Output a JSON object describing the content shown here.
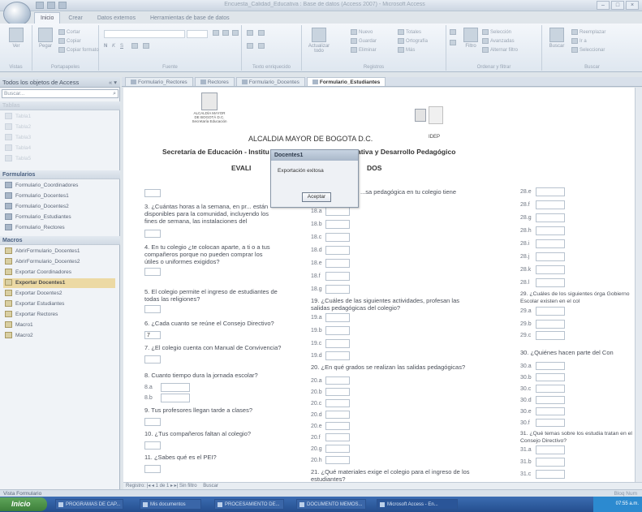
{
  "window": {
    "title": "Encuesta_Calidad_Educativa : Base de datos (Access 2007) - Microsoft Access"
  },
  "ribbon": {
    "tabs": [
      "Inicio",
      "Crear",
      "Datos externos",
      "Herramientas de base de datos"
    ],
    "groups": [
      "Vistas",
      "Portapapeles",
      "Fuente",
      "Texto enriquecido",
      "Registros",
      "Ordenar y filtrar",
      "Buscar"
    ],
    "buttons": {
      "ver": "Ver",
      "pegar": "Pegar",
      "cortar": "Cortar",
      "copiar": "Copiar",
      "copiar_formato": "Copiar formato",
      "actualizar": "Actualizar todo",
      "nuevo": "Nuevo",
      "guardar": "Guardar",
      "eliminar": "Eliminar",
      "totales": "Totales",
      "ortografia": "Ortografía",
      "mas": "Más",
      "filtro": "Filtro",
      "seleccion": "Selección",
      "avanzadas": "Avanzadas",
      "alternar_filtro": "Alternar filtro",
      "buscar": "Buscar",
      "reemplazar": "Reemplazar",
      "ir_a": "Ir a",
      "seleccionar": "Seleccionar"
    }
  },
  "nav": {
    "header": "Todos los objetos de Access",
    "search_placeholder": "Buscar...",
    "sections": {
      "tablas": "Tablas",
      "formularios": "Formularios",
      "macros": "Macros"
    },
    "tablas": [
      "Tabla1",
      "Tabla2",
      "Tabla3",
      "Tabla4",
      "Tabla5"
    ],
    "formularios": [
      "Formulario_Coordinadores",
      "Formulario_Docentes1",
      "Formulario_Docentes2",
      "Formulario_Estudiantes",
      "Formulario_Rectores"
    ],
    "macros": [
      "AbrirFormulario_Docentes1",
      "AbrirFormulario_Docentes2",
      "Exportar Coordinadores",
      "Exportar Docentes1",
      "Exportar Docentes2",
      "Exportar Estudiantes",
      "Exportar Rectores",
      "Macro1",
      "Macro2"
    ]
  },
  "doctabs": [
    "Formulario_Rectores",
    "Rectores",
    "Formulario_Docentes",
    "Formulario_Estudiantes"
  ],
  "form": {
    "alcaldia": "ALCALDIA MAYOR DE BOGOTA D.C.",
    "secretaria_left": "Secretaría de Educación - Institu",
    "secretaria_right": "ativa y Desarrollo Pedagógico",
    "evaluacion_left": "EVALI",
    "evaluacion_right": "DOS",
    "logo_text": "ALCALDÍA MAYOR DE BOGOTÁ D.C. Secretaría Educación",
    "idep": "IDEP",
    "col1": {
      "q3": "3. ¿Cuántas horas a la semana, en pr... están disponibles para la comunidad, incluyendo los fines de semana, las instalaciones del",
      "q4": "4. En tu colegio ¿te colocan aparte, a ti o a tus compañeros  porque no pueden comprar los útiles o uniformes exigidos?",
      "q5": "5. El colegio permite el ingreso de estudiantes de todas las religiones?",
      "q6": "6. ¿Cada cuanto se reúne el Consejo Directivo?",
      "q6_value": "7",
      "q7": "7. ¿El colegio cuenta con Manual de Convivencia?",
      "q8": "8. Cuanto tiempo dura la jornada escolar?",
      "q8a": "8.a",
      "q8b": "8.b",
      "q9": "9. Tus profesores llegan tarde a clases?",
      "q10": "10. ¿Tus compañeros faltan al colegio?",
      "q11": "11. ¿Sabes qué es el PEI?"
    },
    "col2": {
      "q17_tail": "...sa pedagógica en tu colegio tiene",
      "items18": [
        "18.a",
        "18.b",
        "18.c",
        "18.d",
        "18.e",
        "18.f",
        "18.g"
      ],
      "q19": "19. ¿Cuáles de las siguientes actividades, profesan las salidas pedagógicas del colegio?",
      "items19": [
        "19.a",
        "19.b",
        "19.c",
        "19.d"
      ],
      "q20": "20. ¿En qué grados se realizan las salidas pedagógicas?",
      "items20": [
        "20.a",
        "20.b",
        "20.c",
        "20.d",
        "20.e",
        "20.f",
        "20.g",
        "20.h"
      ],
      "q21": "21. ¿Qué materiales exige el colegio para el ingreso de los estudiantes?"
    },
    "col3": {
      "items28": [
        "28.e",
        "28.f",
        "28.g",
        "28.h",
        "28.i",
        "28.j",
        "28.k",
        "28.l"
      ],
      "q29": "29. ¿Cuáles de los siguientes órga Gobierno Escolar existen en el col",
      "items29": [
        "29.a",
        "29.b",
        "29.c"
      ],
      "q30": "30. ¿Quiénes hacen parte del Con",
      "items30": [
        "30.a",
        "30.b",
        "30.c",
        "30.d",
        "30.e",
        "30.f"
      ],
      "q31": "31. ¿Qué temas sobre los estudia tratan en el Consejo Directivo?",
      "items31": [
        "31.a",
        "31.b",
        "31.c"
      ]
    }
  },
  "recordnav": {
    "label": "Registro:",
    "position": "1 de 1",
    "filter": "Sin filtro",
    "search": "Buscar"
  },
  "dialog": {
    "title": "Docentes1",
    "message": "Exportación exitosa",
    "button": "Aceptar"
  },
  "status": {
    "left": "Vista Formulario",
    "right": "Bloq Num"
  },
  "taskbar": {
    "start": "Inicio",
    "tasks": [
      "PROGRAMAS DE CAP...",
      "Mis documentos",
      "PROCESAMIENTO DE...",
      "DOCUMENTO MEMOS...",
      "Microsoft Access - En..."
    ],
    "clock": "07:55 a.m."
  }
}
